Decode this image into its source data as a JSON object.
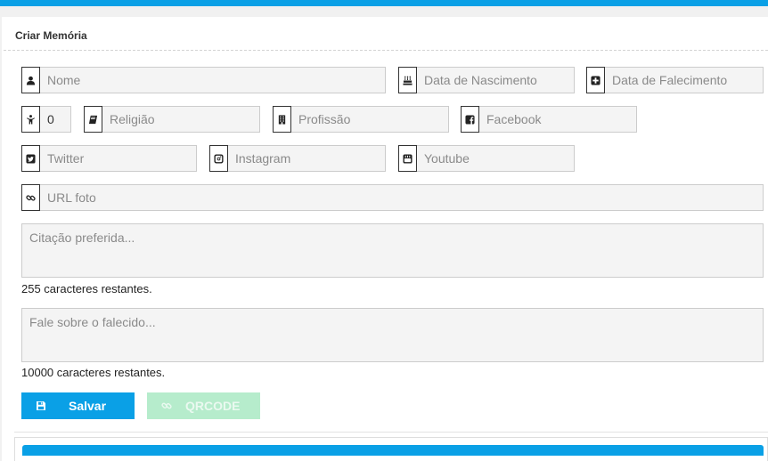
{
  "panel": {
    "title": "Criar Memória"
  },
  "fields": {
    "nome": {
      "placeholder": "Nome",
      "icon": "user-icon"
    },
    "nascimento": {
      "placeholder": "Data de Nascimento",
      "icon": "birthday-cake-icon"
    },
    "falecimento": {
      "placeholder": "Data de Falecimento",
      "icon": "plus-square-icon"
    },
    "idade": {
      "value": "0",
      "icon": "child-icon"
    },
    "religiao": {
      "placeholder": "Religião",
      "icon": "book-icon"
    },
    "profissao": {
      "placeholder": "Profissão",
      "icon": "building-icon"
    },
    "facebook": {
      "placeholder": "Facebook",
      "icon": "facebook-icon"
    },
    "twitter": {
      "placeholder": "Twitter",
      "icon": "twitter-icon"
    },
    "instagram": {
      "placeholder": "Instagram",
      "icon": "instagram-icon"
    },
    "youtube": {
      "placeholder": "Youtube",
      "icon": "youtube-icon"
    },
    "url_foto": {
      "placeholder": "URL foto",
      "icon": "link-icon"
    }
  },
  "citacao": {
    "placeholder": "Citação preferida...",
    "counter": "255 caracteres restantes."
  },
  "sobre": {
    "placeholder": "Fale sobre o falecido...",
    "counter": "10000 caracteres restantes."
  },
  "buttons": {
    "save": {
      "label": "Salvar",
      "icon": "save-icon"
    },
    "qrcode": {
      "label": "QRCODE",
      "icon": "link-icon"
    }
  },
  "colors": {
    "accent": "#0aa0e6",
    "qr_disabled": "#b6eccc"
  }
}
